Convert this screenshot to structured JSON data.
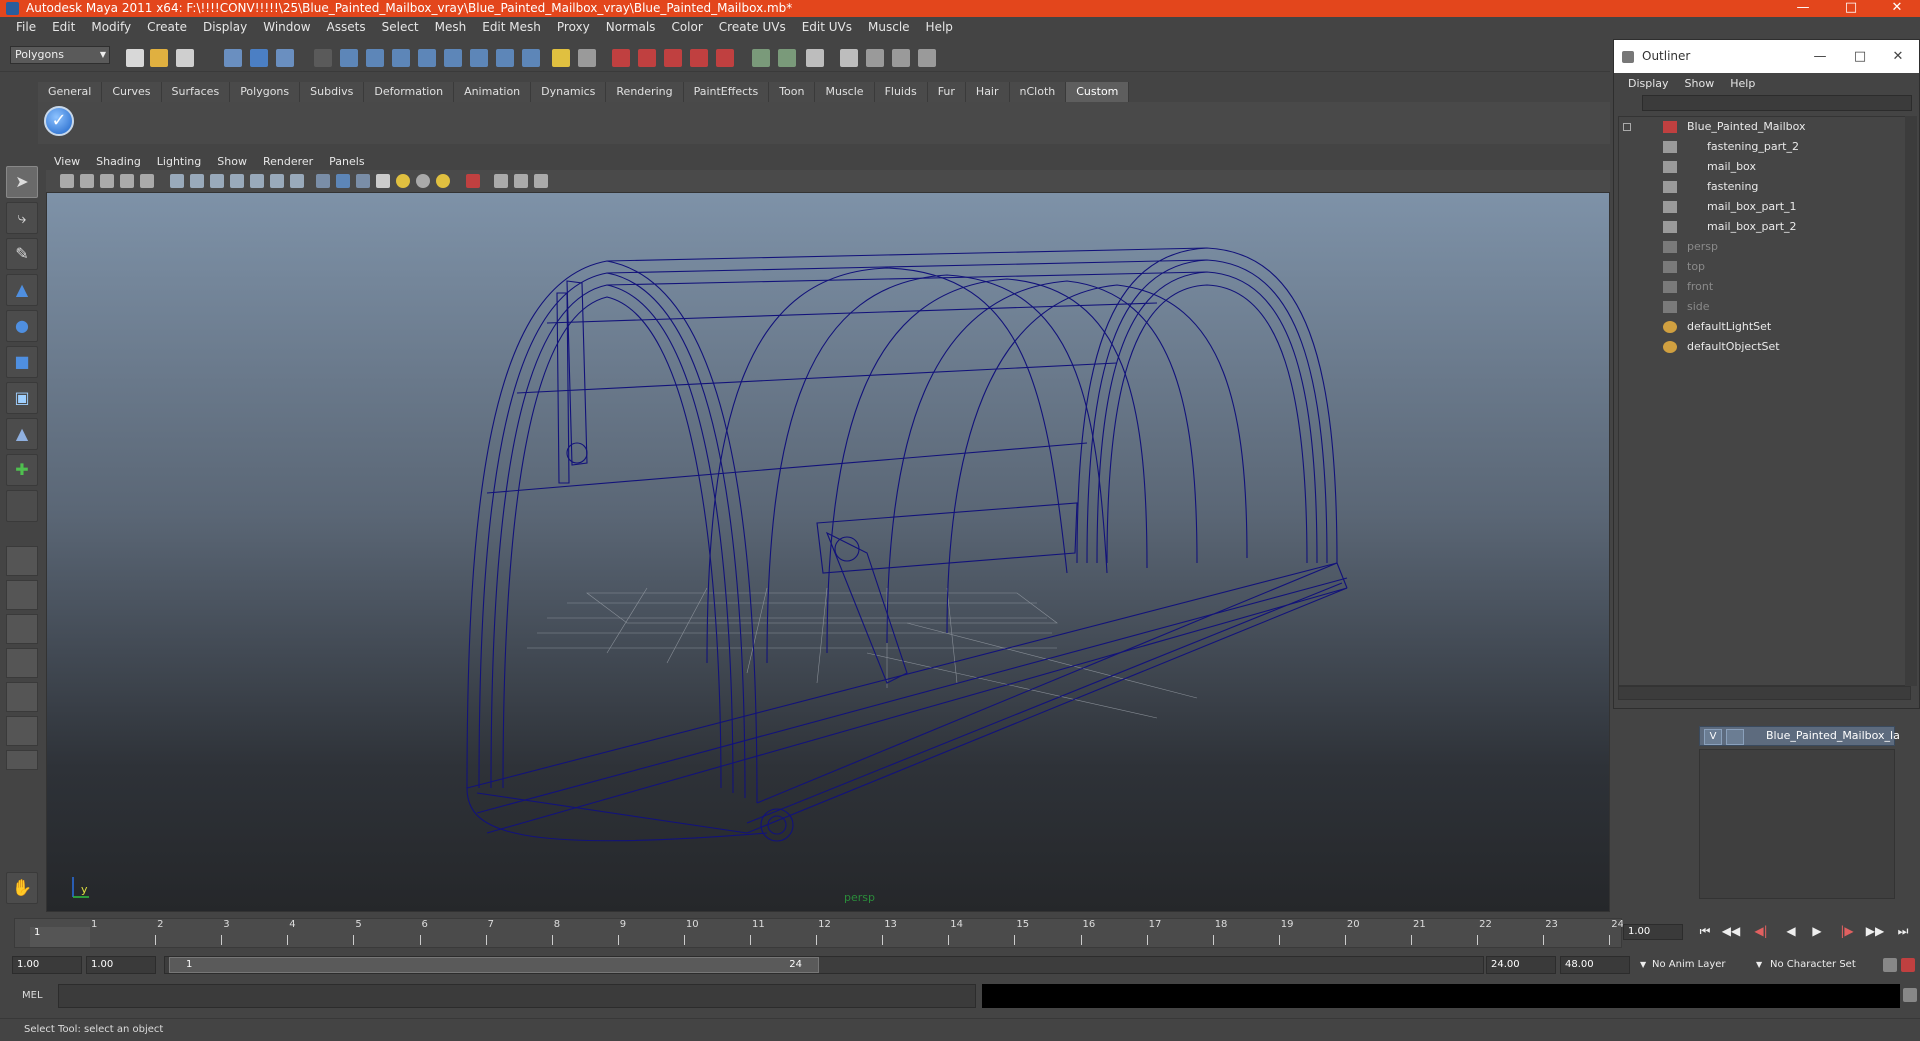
{
  "window": {
    "title": "Autodesk Maya 2011 x64: F:\\!!!!CONV!!!!!\\25\\Blue_Painted_Mailbox_vray\\Blue_Painted_Mailbox_vray\\Blue_Painted_Mailbox.mb*",
    "accent": "#e3461c"
  },
  "menubar": [
    "File",
    "Edit",
    "Modify",
    "Create",
    "Display",
    "Window",
    "Assets",
    "Select",
    "Mesh",
    "Edit Mesh",
    "Proxy",
    "Normals",
    "Color",
    "Create UVs",
    "Edit UVs",
    "Muscle",
    "Help"
  ],
  "statusline": {
    "mode": "Polygons"
  },
  "shelf": {
    "tabs": [
      "General",
      "Curves",
      "Surfaces",
      "Polygons",
      "Subdivs",
      "Deformation",
      "Animation",
      "Dynamics",
      "Rendering",
      "PaintEffects",
      "Toon",
      "Muscle",
      "Fluids",
      "Fur",
      "Hair",
      "nCloth",
      "Custom"
    ],
    "active": "Custom"
  },
  "panel": {
    "menus": [
      "View",
      "Shading",
      "Lighting",
      "Show",
      "Renderer",
      "Panels"
    ],
    "camera": "persp"
  },
  "outliner": {
    "title": "Outliner",
    "menus": [
      "Display",
      "Show",
      "Help"
    ],
    "items": [
      {
        "label": "Blue_Painted_Mailbox",
        "kind": "root"
      },
      {
        "label": "fastening_part_2",
        "kind": "child"
      },
      {
        "label": "mail_box",
        "kind": "child"
      },
      {
        "label": "fastening",
        "kind": "child"
      },
      {
        "label": "mail_box_part_1",
        "kind": "child"
      },
      {
        "label": "mail_box_part_2",
        "kind": "child"
      },
      {
        "label": "persp",
        "kind": "camera"
      },
      {
        "label": "top",
        "kind": "camera"
      },
      {
        "label": "front",
        "kind": "camera"
      },
      {
        "label": "side",
        "kind": "camera"
      },
      {
        "label": "defaultLightSet",
        "kind": "set"
      },
      {
        "label": "defaultObjectSet",
        "kind": "set"
      }
    ]
  },
  "layers": {
    "visible_flag": "V",
    "name": "Blue_Painted_Mailbox_la"
  },
  "timeline": {
    "ticks": [
      "1",
      "2",
      "3",
      "4",
      "5",
      "6",
      "7",
      "8",
      "9",
      "10",
      "11",
      "12",
      "13",
      "14",
      "15",
      "16",
      "17",
      "18",
      "19",
      "20",
      "21",
      "22",
      "23",
      "24"
    ],
    "current_frame_label": "1",
    "current_frame": "1.00"
  },
  "range": {
    "start": "1.00",
    "playback_start": "1.00",
    "slider_start": "1",
    "slider_end": "24",
    "playback_end": "24.00",
    "end": "48.00",
    "anim_layer": "No Anim Layer",
    "character_set": "No Character Set"
  },
  "cmd": {
    "lang": "MEL"
  },
  "help": {
    "text": "Select Tool: select an object"
  }
}
